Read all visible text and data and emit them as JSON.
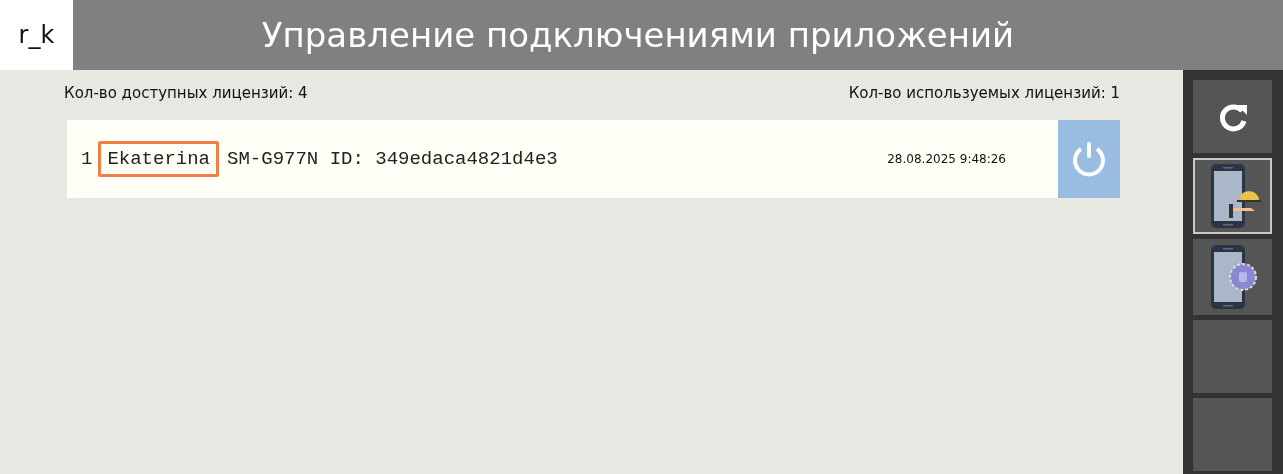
{
  "logo": "r_k",
  "window": {
    "title": "Управление подключениями приложений"
  },
  "stats": {
    "available": "Кол-во доступных лицензий: 4",
    "used": "Кол-во используемых лицензий: 1"
  },
  "connections": [
    {
      "index": "1",
      "name": "Ekaterina",
      "highlighted": true,
      "device": "SM-G977N ID: 349edaca4821d4e3",
      "time": "28.08.2025 9:48:26"
    }
  ],
  "sidebar": [
    {
      "kind": "refresh",
      "selected": false
    },
    {
      "kind": "waiter",
      "selected": true
    },
    {
      "kind": "settings",
      "selected": false
    },
    {
      "kind": "empty",
      "selected": false
    },
    {
      "kind": "empty",
      "selected": false
    }
  ]
}
